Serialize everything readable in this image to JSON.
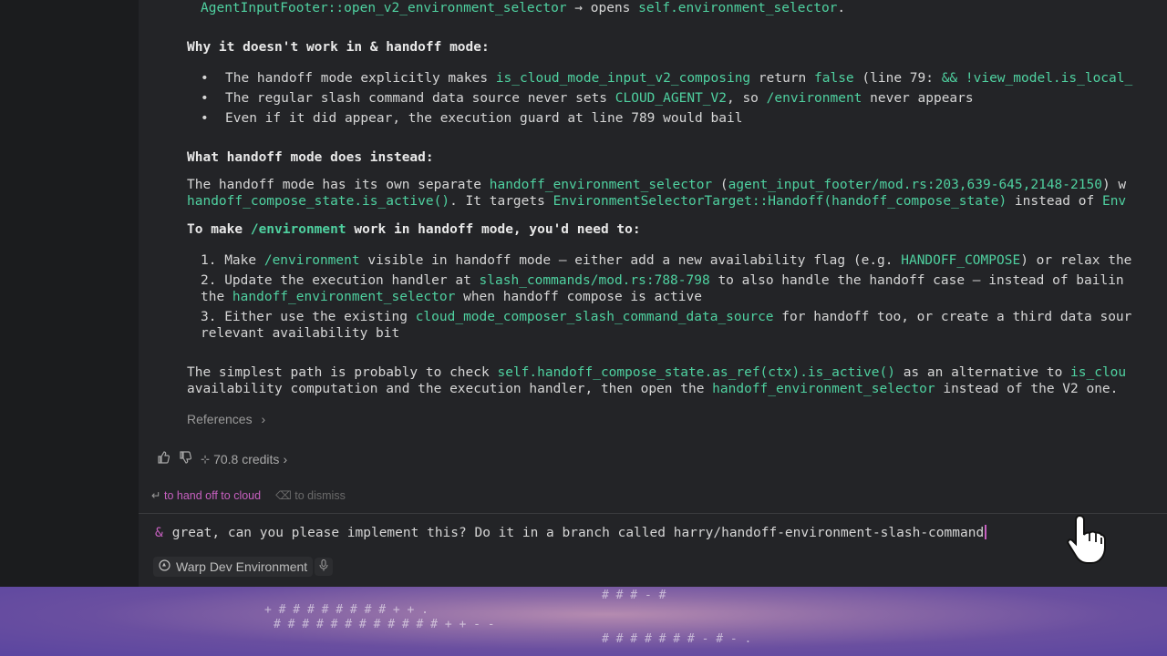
{
  "lines": {
    "l0": {
      "a": "AgentInputFooter::open_v2_environment_selector",
      "b": " → opens ",
      "c": "self.environment_selector",
      "d": "."
    },
    "why_heading": "Why it doesn't work in & handoff mode:",
    "b1": {
      "a": "The handoff mode explicitly makes ",
      "b": "is_cloud_mode_input_v2_composing",
      "c": " return ",
      "d": "false",
      "e": " (line 79: ",
      "f": "&& !view_model.is_local_"
    },
    "b2": {
      "a": "The regular slash command data source never sets ",
      "b": "CLOUD_AGENT_V2",
      "c": ", so ",
      "d": "/environment",
      "e": " never appears"
    },
    "b3": "Even if it did appear, the execution guard at line 789 would bail",
    "what_heading": "What handoff mode does instead:",
    "p1a": {
      "a": "The handoff mode has its own separate ",
      "b": "handoff_environment_selector",
      "c": " (",
      "d": "agent_input_footer/mod.rs:203,639-645,2148-2150",
      "e": ") w"
    },
    "p1b": {
      "a": "handoff_compose_state.is_active()",
      "b": ". It targets ",
      "c": "EnvironmentSelectorTarget::Handoff(handoff_compose_state)",
      "d": " instead of ",
      "e": "Env"
    },
    "make_heading": {
      "a": "To make ",
      "b": "/environment",
      "c": " work in handoff mode, you'd need to:"
    },
    "n1": {
      "a": "1. Make ",
      "b": "/environment",
      "c": " visible in handoff mode — either add a new availability flag (e.g. ",
      "d": "HANDOFF_COMPOSE",
      "e": ") or relax the"
    },
    "n2a": {
      "a": "2. Update the execution handler at ",
      "b": "slash_commands/mod.rs:788-798",
      "c": " to also handle the handoff case — instead of bailin"
    },
    "n2b": {
      "a": "the ",
      "b": "handoff_environment_selector",
      "c": " when handoff compose is active"
    },
    "n3a": {
      "a": "3. Either use the existing ",
      "b": "cloud_mode_composer_slash_command_data_source",
      "c": " for handoff too, or create a third data sour"
    },
    "n3b": "relevant availability bit",
    "s1": {
      "a": "The simplest path is probably to check ",
      "b": "self.handoff_compose_state.as_ref(ctx).is_active()",
      "c": " as an alternative to ",
      "d": "is_clou"
    },
    "s2": {
      "a": "availability computation and the execution handler, then open the ",
      "b": "handoff_environment_selector",
      "c": " instead of the V2 one."
    }
  },
  "references_label": "References",
  "credits_label": "70.8 credits",
  "hints": {
    "handoff": "to hand off to cloud",
    "dismiss": "to dismiss"
  },
  "input": {
    "prefix": "&",
    "value": "great, can you please implement this? Do it in a branch called harry/handoff-environment-slash-command"
  },
  "environment_chip": "Warp Dev Environment",
  "banner_lines": [
    "# # # - #",
    "+ # # # # # # # # + + .",
    "# # # # # # # # # # # # + + - -",
    "# # # # # # # - # - ."
  ]
}
